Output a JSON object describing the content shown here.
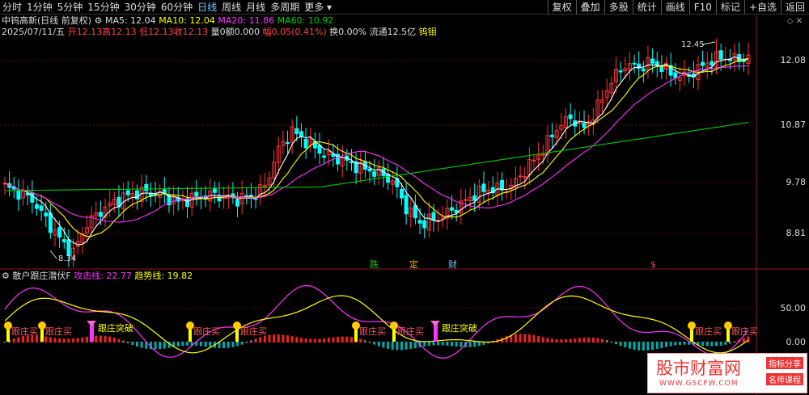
{
  "toolbar": {
    "timeframes": [
      "分时",
      "1分钟",
      "5分钟",
      "15分钟",
      "30分钟",
      "60分钟",
      "日线",
      "周线",
      "月线",
      "多周期",
      "更多"
    ],
    "active_index": 6,
    "right_buttons": [
      "复权",
      "叠加",
      "多股",
      "统计",
      "画线",
      "F10",
      "标记",
      "+自选",
      "返回"
    ]
  },
  "header": {
    "stock": "中钨高新(日线 前复权)",
    "ma5": "MA5: 12.04",
    "ma10": "MA10: 12.04",
    "ma20": "MA20: 11.86",
    "ma60": "MA60: 10.92",
    "date": "2025/07/11/五",
    "open": "开12.13",
    "high": "高12.13",
    "low": "低12.13",
    "close": "收12.13",
    "volume": "量0",
    "amount": "额0.000",
    "change": "幅0.05(0.41%)",
    "turnover": "换0.00%",
    "float": "流通12.5亿",
    "sector": "钨钼"
  },
  "axis": {
    "labels": [
      "12.08",
      "10.87",
      "9.78",
      "8.81"
    ],
    "sub_labels": [
      "50.00",
      "0.00"
    ]
  },
  "annotations": {
    "high_label": "12.45",
    "low_label": "8.34",
    "chips": [
      "跌",
      "定",
      "财",
      "$"
    ]
  },
  "indicator": {
    "name": "散户跟庄潜伏F",
    "attack": "攻击线: 22.77",
    "trend": "趋势线: 19.82"
  },
  "signals": {
    "buy": "跟庄买",
    "breakout": "跟庄突破",
    "icon": "$"
  },
  "colors": {
    "up": "#ff3333",
    "down": "#00ffff",
    "ma5": "#ffffff",
    "ma10": "#ffff00",
    "ma20": "#ff33ff",
    "ma60": "#00cc00"
  },
  "watermark": {
    "title": "股市财富网",
    "url": "WWW.GSCFW.COM",
    "tag1": "指标分享",
    "tag2": "名师课程"
  }
}
